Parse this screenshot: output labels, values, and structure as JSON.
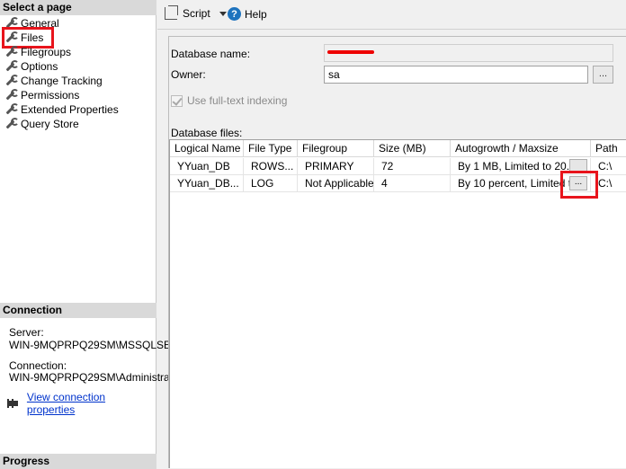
{
  "left_pane": {
    "select_header": "Select a page",
    "pages": [
      "General",
      "Files",
      "Filegroups",
      "Options",
      "Change Tracking",
      "Permissions",
      "Extended Properties",
      "Query Store"
    ],
    "connection_header": "Connection",
    "server_label": "Server:",
    "server_value": "WIN-9MQPRPQ29SM\\MSSQLSE",
    "connection_label": "Connection:",
    "connection_value": "WIN-9MQPRPQ29SM\\Administrat",
    "view_connection_link": "View connection properties",
    "progress_header": "Progress"
  },
  "toolbar": {
    "script_label": "Script",
    "help_label": "Help"
  },
  "form": {
    "database_name_label": "Database name:",
    "owner_label": "Owner:",
    "owner_value": "sa",
    "ellipsis": "...",
    "fulltext_label": "Use full-text indexing",
    "database_files_label": "Database files:"
  },
  "grid": {
    "columns": [
      "Logical Name",
      "File Type",
      "Filegroup",
      "Size (MB)",
      "Autogrowth / Maxsize",
      "Path"
    ],
    "rows": [
      [
        "YYuan_DB",
        "ROWS...",
        "PRIMARY",
        "72",
        "By 1 MB, Limited to 20...",
        "C:\\"
      ],
      [
        "YYuan_DB...",
        "LOG",
        "Not Applicable",
        "4",
        "By 10 percent, Limited t...",
        "C:\\"
      ]
    ],
    "cell_button": "..."
  },
  "colors": {
    "highlight": "#e8141c",
    "link": "#0033cc"
  }
}
